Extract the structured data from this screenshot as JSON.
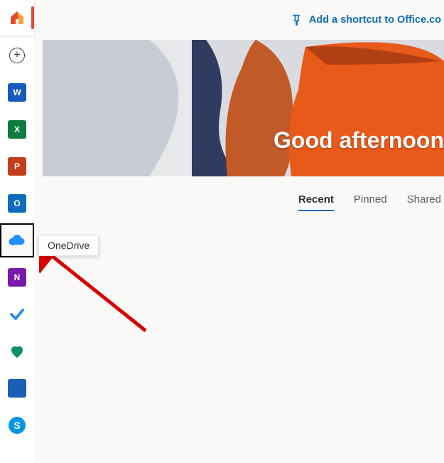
{
  "shortcut": {
    "label": "Add a shortcut to Office.co"
  },
  "hero": {
    "greeting": "Good afternoon"
  },
  "tabs": {
    "recent": "Recent",
    "pinned": "Pinned",
    "shared": "Shared"
  },
  "sidebar": {
    "tooltip": "OneDrive",
    "items": [
      {
        "kind": "home",
        "name": "home"
      },
      {
        "kind": "create",
        "name": "create"
      },
      {
        "kind": "word",
        "name": "Word",
        "letter": "W",
        "color": "#185abd"
      },
      {
        "kind": "excel",
        "name": "Excel",
        "letter": "X",
        "color": "#107c41"
      },
      {
        "kind": "ppt",
        "name": "PowerPoint",
        "letter": "P",
        "color": "#c43e1c"
      },
      {
        "kind": "outlook",
        "name": "Outlook",
        "letter": "O",
        "color": "#0f6cbd"
      },
      {
        "kind": "onedrive",
        "name": "OneDrive",
        "selected": true
      },
      {
        "kind": "onenote",
        "name": "OneNote",
        "letter": "N",
        "color": "#7719aa"
      },
      {
        "kind": "todo",
        "name": "To Do"
      },
      {
        "kind": "health",
        "name": "Family Safety"
      },
      {
        "kind": "calendar",
        "name": "Calendar",
        "color": "#0f6cbd"
      },
      {
        "kind": "skype",
        "name": "Skype",
        "letter": "S",
        "color": "#0098e3"
      }
    ]
  }
}
